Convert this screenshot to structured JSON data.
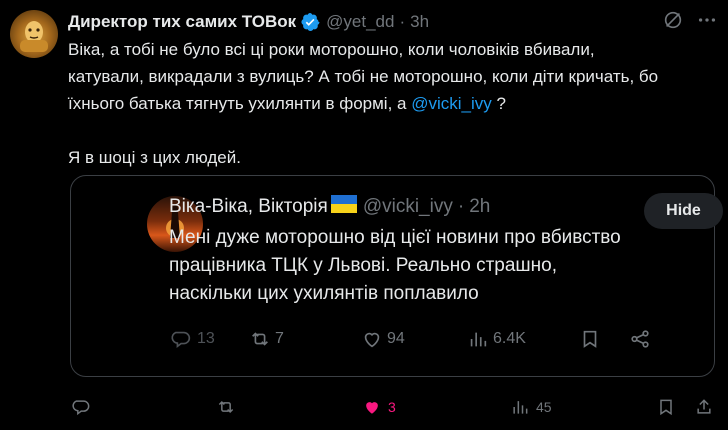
{
  "tweet": {
    "author_name": "Директор тих самих ТОВок",
    "handle": "@yet_dd",
    "time": "3h",
    "separator": "·",
    "text_line1": "Віка, а тобі не було всі ці роки моторошно, коли чоловіків вбивали,",
    "text_line2": "катували, викрадали з вулиць? А тобі не моторошно, коли діти кричать, бо",
    "text_line3a": "їхнього батька тягнуть ухилянти в формі, а ",
    "text_line3_mention": "@vicki_ivy",
    "text_line3b": " ?",
    "text_line4": "Я в шоці з цих людей.",
    "icons": {
      "verified": "verified-badge-icon",
      "grok": "grok-icon",
      "more": "more-icon"
    },
    "accent_color": "#1d9bf0"
  },
  "quote": {
    "author_name": "Віка-Віка, Вікторія",
    "flag": "ukraine-flag-emoji",
    "handle": "@vicki_ivy",
    "separator": "·",
    "time": "2h",
    "hide_label": "Hide",
    "text_line1": "Мені дуже моторошно від цієї новини про вбивство",
    "text_line2": "працівника ТЦК у Львові. Реально страшно,",
    "text_line3": "наскільки цих ухилянтів поплавило",
    "replies": "13",
    "reposts": "7",
    "likes": "94",
    "views": "6.4K"
  },
  "actions": {
    "likes": "3",
    "views": "45",
    "like_color": "#f91880"
  }
}
